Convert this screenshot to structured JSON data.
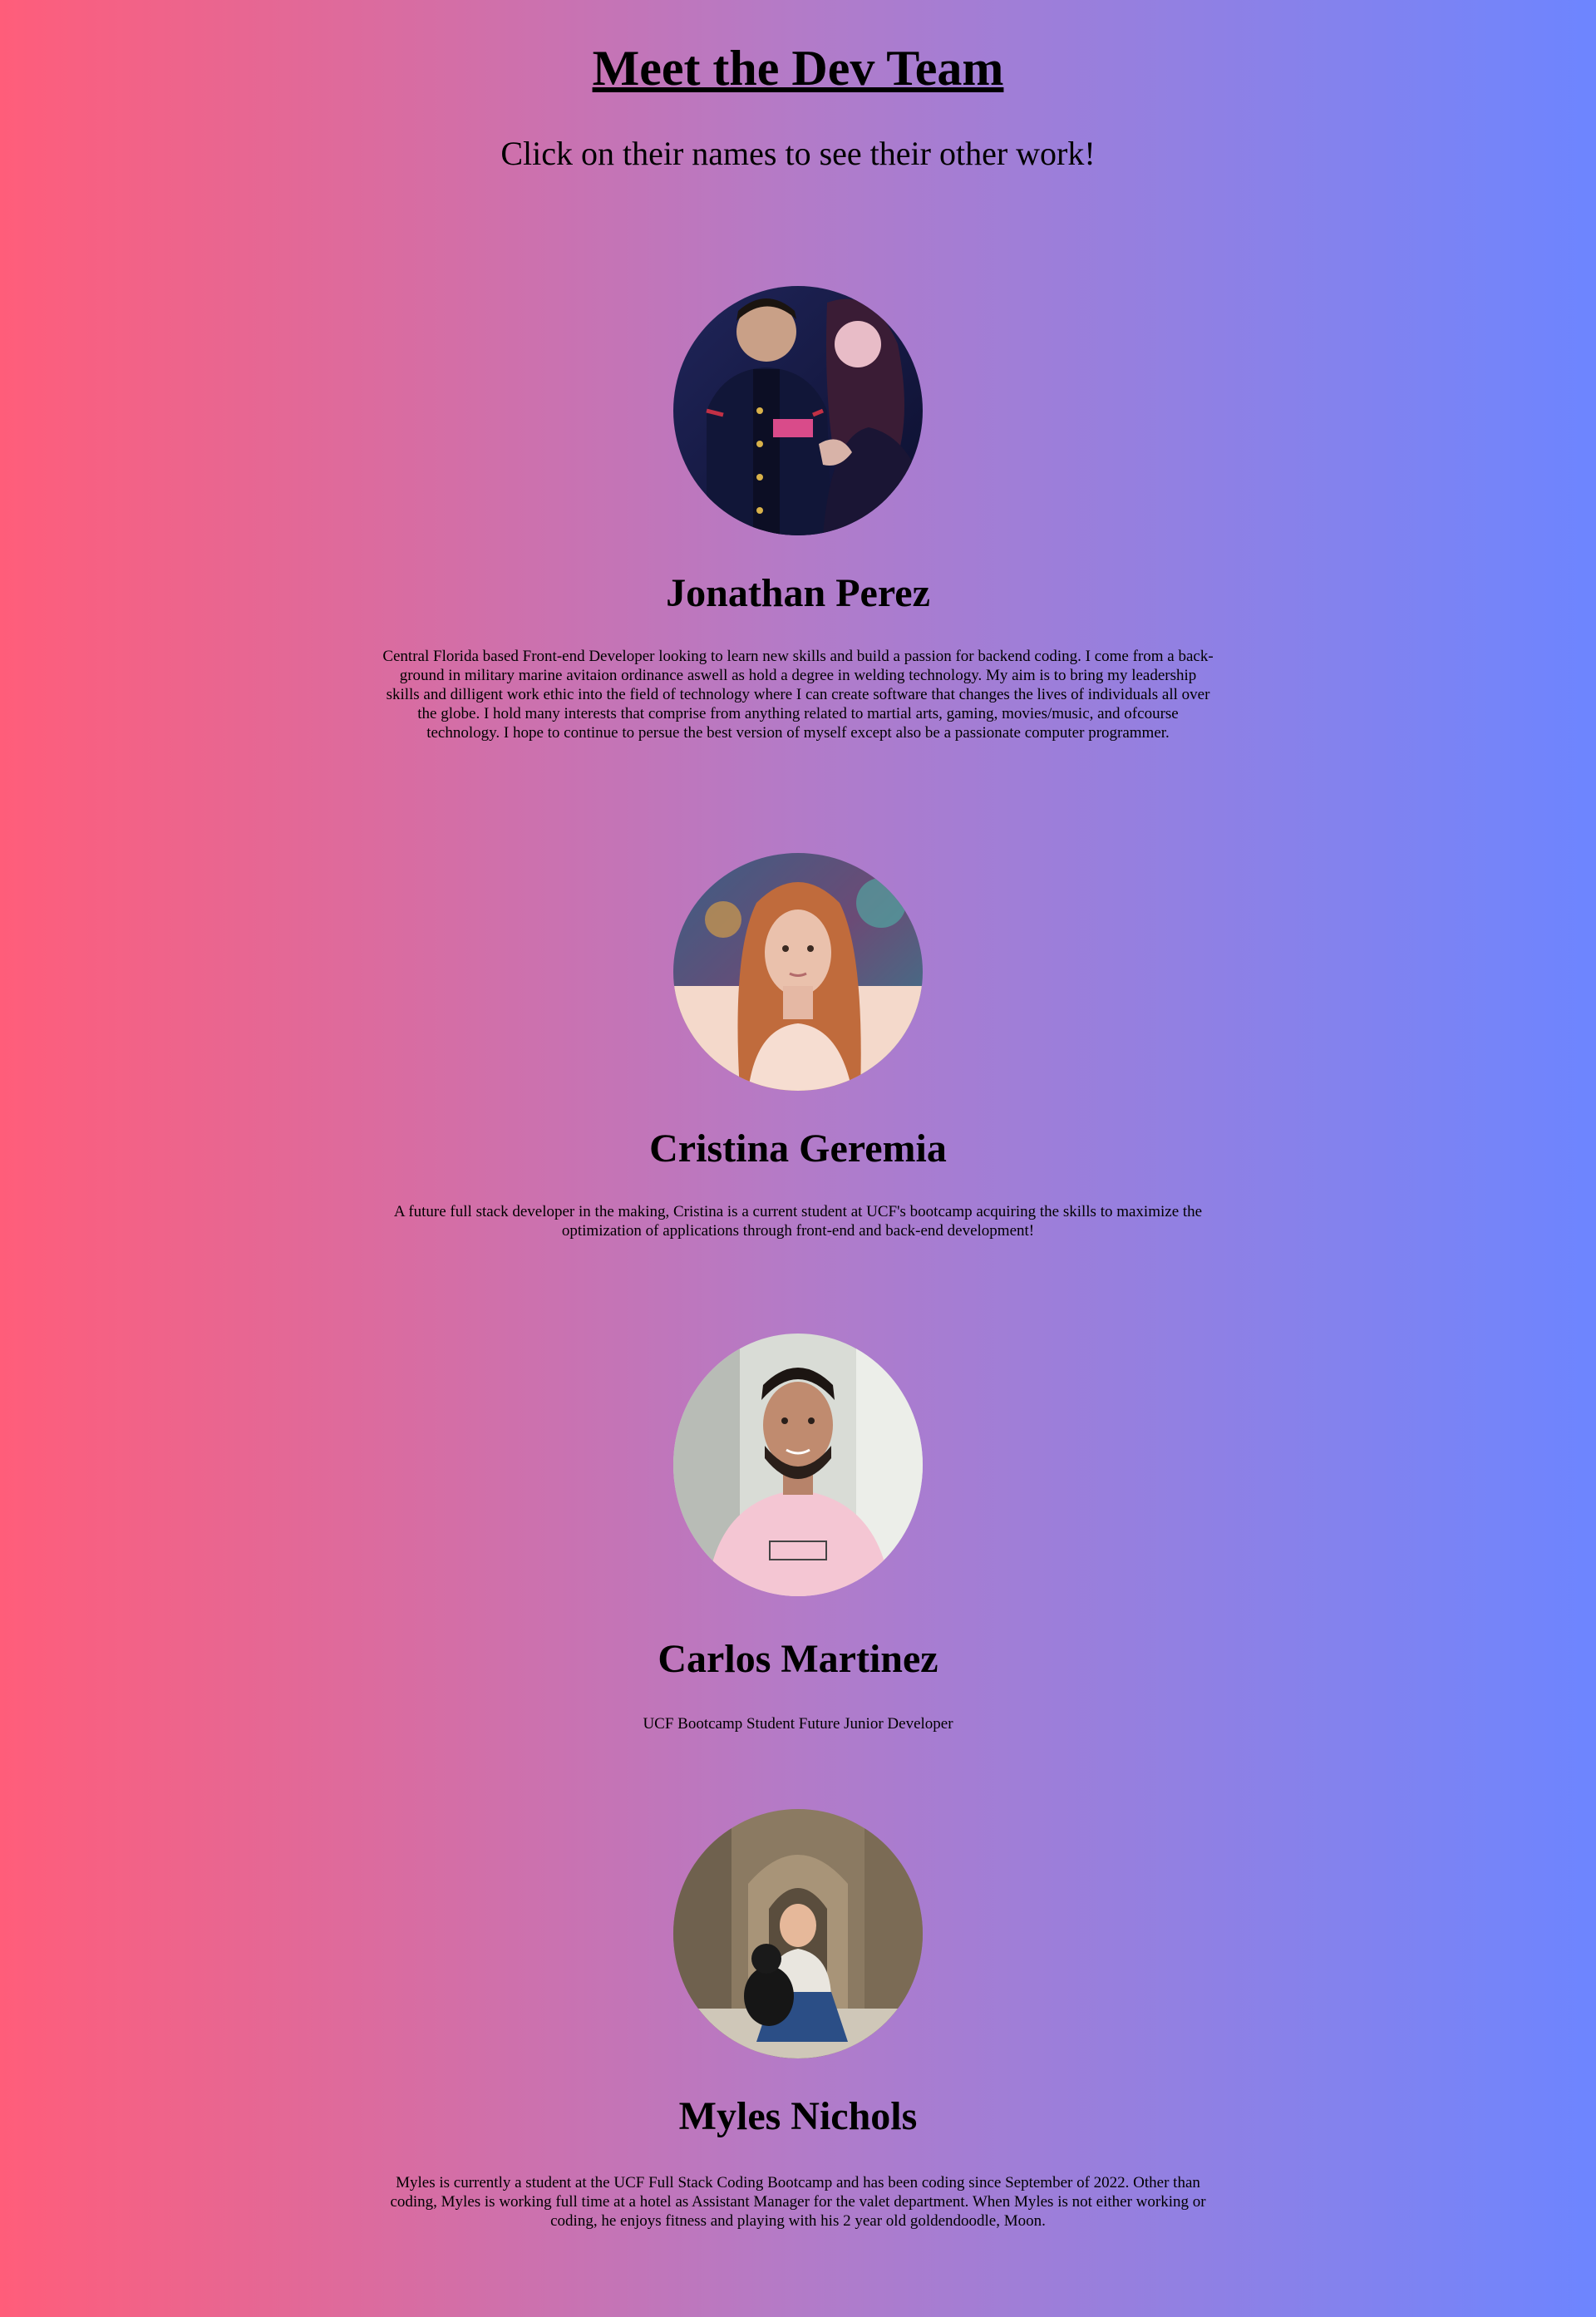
{
  "header": {
    "title": "Meet the Dev Team",
    "subtitle": "Click on their names to see their other work!"
  },
  "members": [
    {
      "name": "Jonathan Perez",
      "bio": "Central Florida based Front-end Developer looking to learn new skills and build a passion for backend coding. I come from a back-ground in military marine avitaion ordinance aswell as hold a degree in welding technology. My aim is to bring my leadership skills and dilligent work ethic into the field of technology where I can create software that changes the lives of individuals all over the globe. I hold many interests that comprise from anything related to martial arts, gaming, movies/music, and ofcourse technology. I hope to continue to persue the best version of myself except also be a passionate computer programmer."
    },
    {
      "name": "Cristina Geremia",
      "bio": "A future full stack developer in the making, Cristina is a current student at UCF's bootcamp acquiring the skills to maximize the optimization of applications through front-end and back-end development!"
    },
    {
      "name": "Carlos Martinez",
      "bio": "UCF Bootcamp Student Future Junior Developer"
    },
    {
      "name": "Myles Nichols",
      "bio": "Myles is currently a student at the UCF Full Stack Coding Bootcamp and has been coding since September of 2022. Other than coding, Myles is working full time at a hotel as Assistant Manager for the valet department. When Myles is not either working or coding, he enjoys fitness and playing with his 2 year old goldendoodle, Moon."
    }
  ],
  "colors": {
    "gradient_left": "#ff5d7a",
    "gradient_mid": "#b37bc8",
    "gradient_right": "#6d85ff"
  }
}
